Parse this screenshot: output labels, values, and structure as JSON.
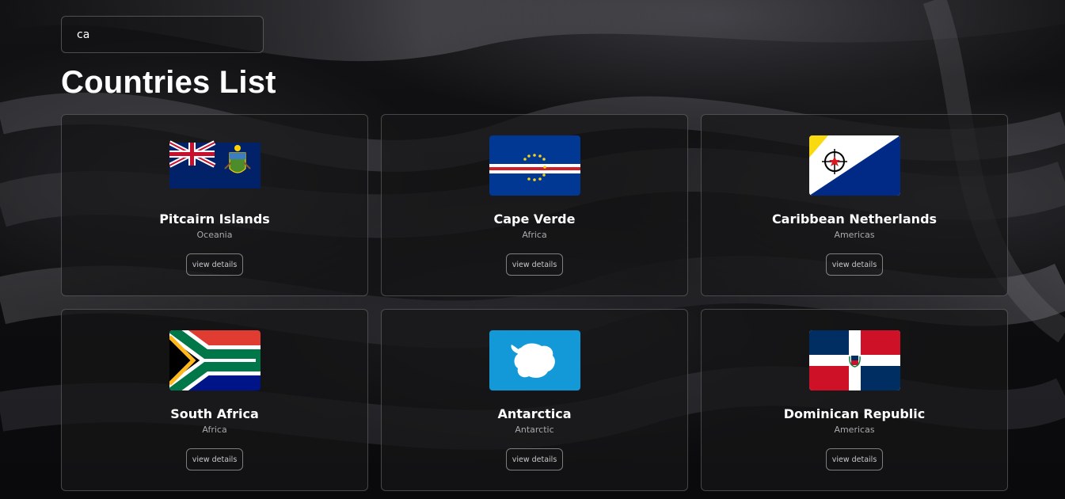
{
  "search": {
    "value": "ca",
    "placeholder": ""
  },
  "page_title": "Countries List",
  "countries": [
    {
      "name": "Pitcairn Islands",
      "region": "Oceania",
      "button": "view details",
      "flag_icon": "pitcairn-islands-flag"
    },
    {
      "name": "Cape Verde",
      "region": "Africa",
      "button": "view details",
      "flag_icon": "cape-verde-flag"
    },
    {
      "name": "Caribbean Netherlands",
      "region": "Americas",
      "button": "view details",
      "flag_icon": "caribbean-netherlands-flag"
    },
    {
      "name": "South Africa",
      "region": "Africa",
      "button": "view details",
      "flag_icon": "south-africa-flag"
    },
    {
      "name": "Antarctica",
      "region": "Antarctic",
      "button": "view details",
      "flag_icon": "antarctica-flag"
    },
    {
      "name": "Dominican Republic",
      "region": "Americas",
      "button": "view details",
      "flag_icon": "dominican-republic-flag"
    }
  ],
  "colors": {
    "background": "#0b0b0d",
    "card_background": "#161618",
    "card_border": "#3a3a3d",
    "text_primary": "#ffffff",
    "text_secondary": "#a9a9ad"
  }
}
